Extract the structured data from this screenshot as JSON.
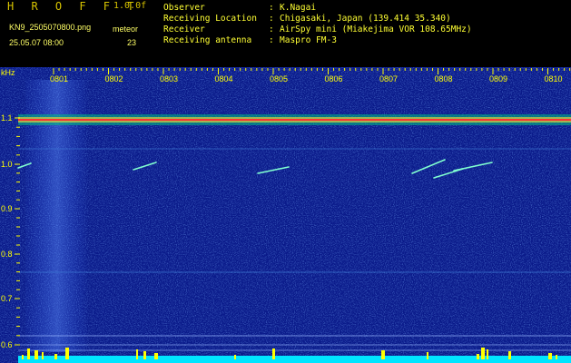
{
  "header": {
    "logo": "H R O F F T",
    "version": "1.0.0f",
    "filename": "KN9_2505070800.png",
    "meteor_label": "meteor",
    "timestamp": "25.05.07 08:00",
    "meteor_count": "23",
    "info": [
      {
        "key": "Observer",
        "value": "K.Nagai"
      },
      {
        "key": "Receiving Location",
        "value": "Chigasaki, Japan (139.414 35.340)"
      },
      {
        "key": "Receiver",
        "value": "AirSpy mini (Miakejima VOR 108.65MHz)"
      },
      {
        "key": "Receiving antenna",
        "value": "Maspro FM-3"
      }
    ],
    "colon": ":"
  },
  "spectrogram": {
    "y_unit": "kHz",
    "y_ticks": [
      "1.1",
      "1.0",
      "0.9",
      "0.8",
      "0.7",
      "0.6"
    ],
    "x_ticks": [
      "0801",
      "0802",
      "0803",
      "0804",
      "0805",
      "0806",
      "0807",
      "0808",
      "0809",
      "0810"
    ],
    "colors": {
      "background": "#0a1a8a",
      "tick_label": "#ffff00",
      "carrier": "#ff3030",
      "baseline": "#00e5ff",
      "burst": "#ffff00",
      "meteor": "#80ffd0"
    }
  }
}
